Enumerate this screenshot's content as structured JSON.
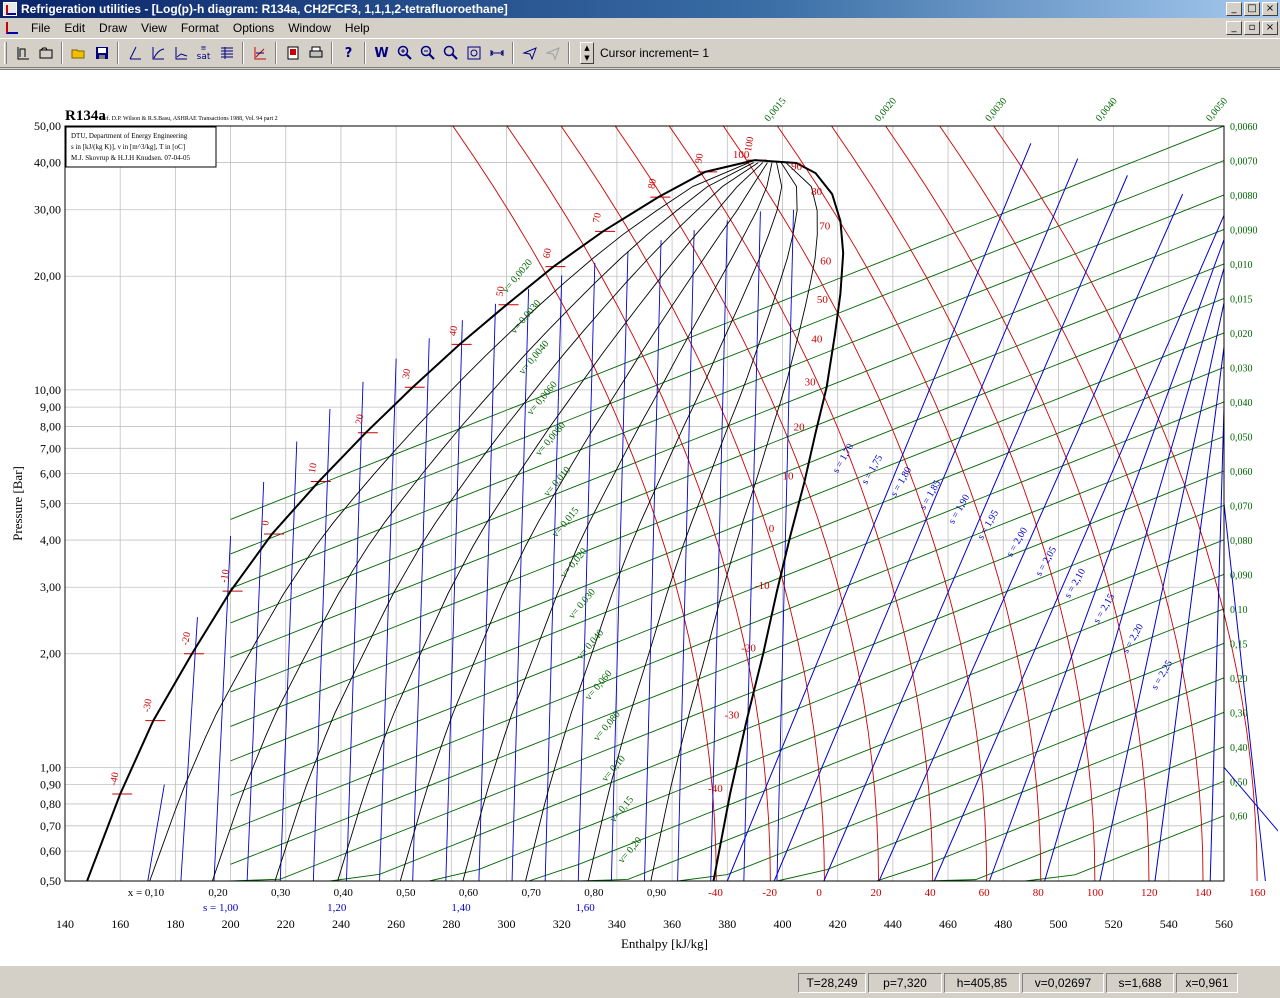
{
  "window": {
    "title": "Refrigeration utilities - [Log(p)-h diagram: R134a, CH2FCF3, 1,1,1,2-tetrafluoroethane]"
  },
  "menu": [
    "File",
    "Edit",
    "Draw",
    "View",
    "Format",
    "Options",
    "Window",
    "Help"
  ],
  "toolbar": {
    "icons": [
      "log-ph-icon",
      "open-folder-icon",
      "folder-icon",
      "save-icon",
      "isentrope-icon",
      "isochore-icon",
      "isotherm-icon",
      "sat-icon",
      "table-icon",
      "cycle-icon",
      "print-preview-icon",
      "print-icon",
      "help-icon",
      "w-icon",
      "zoom-in-icon",
      "zoom-out-icon",
      "zoom-icon",
      "zoom-fit-icon",
      "width-icon",
      "cursor-icon",
      "cursor-disabled-icon"
    ],
    "sat_label": "sat",
    "help_label": "?",
    "w_label": "W",
    "cursor_increment": "Cursor increment= 1"
  },
  "chart": {
    "substance": "R134a",
    "reference": "Ref. D.P. Wilson & R.S.Basu, ASHRAE Transactions 1988, Vol. 94 part 2",
    "info_lines": [
      "DTU, Department of Energy Engineering",
      "s in [kJ/(kg K)], v in [m^3/kg], T in [oC]",
      "M.J. Skovrup & H.J.H Knudsen. 07-04-05"
    ],
    "xlabel": "Enthalpy [kJ/kg]",
    "ylabel": "Pressure [Bar]",
    "x_ticks": [
      "140",
      "160",
      "180",
      "200",
      "220",
      "240",
      "260",
      "280",
      "300",
      "320",
      "340",
      "360",
      "380",
      "400",
      "420",
      "440",
      "460",
      "480",
      "500",
      "520",
      "540",
      "560"
    ],
    "y_ticks": [
      "50,00",
      "40,00",
      "30,00",
      "20,00",
      "10,00",
      "9,00",
      "8,00",
      "7,00",
      "6,00",
      "5,00",
      "4,00",
      "3,00",
      "2,00",
      "1,00",
      "0,90",
      "0,80",
      "0,70",
      "0,60",
      "0,50"
    ],
    "quality_labels": [
      "x = 0,10",
      "0,20",
      "0,30",
      "0,40",
      "0,50",
      "0,60",
      "0,70",
      "0,80",
      "0,90"
    ],
    "entropy_bottom_labels": [
      "s = 1,00",
      "1,20",
      "1,40",
      "1,60"
    ],
    "bottom_temps": [
      "-40",
      "-20",
      "0",
      "20",
      "40",
      "60",
      "80",
      "100",
      "120",
      "140",
      "160"
    ],
    "liquid_temps": [
      "-40",
      "-30",
      "-20",
      "-10",
      "0",
      "10",
      "20",
      "30",
      "40",
      "50",
      "60",
      "70",
      "80",
      "90",
      "100"
    ],
    "vapor_temps": [
      "-40",
      "-30",
      "-20",
      "-10",
      "0",
      "10",
      "20",
      "30",
      "40",
      "50",
      "60",
      "70",
      "80",
      "90",
      "100"
    ],
    "entropy_labels": [
      "s = 1,70",
      "s = 1,75",
      "s = 1,80",
      "s = 1,85",
      "s = 1,90",
      "s = 1,95",
      "s = 2,00",
      "s = 2,05",
      "s = 2,10",
      "s = 2,15",
      "s = 2,20",
      "s = 2,25"
    ],
    "volume_right_labels": [
      "0,0060",
      "0,0070",
      "0,0080",
      "0,0090",
      "0,010",
      "0,015",
      "0,020",
      "0,030",
      "0,040",
      "0,050",
      "0,060",
      "0,070",
      "0,080",
      "0,090",
      "0,10",
      "0,15",
      "0,20",
      "0,30",
      "0,40",
      "0,50",
      "0,60"
    ],
    "volume_top_labels": [
      "0,0015",
      "0,0020",
      "0,0030",
      "0,0040",
      "0,0050"
    ],
    "volume_inner_labels": [
      "v= 0,0020",
      "v= 0,0030",
      "v= 0,0040",
      "v= 0,0060",
      "v= 0,0080",
      "v= 0,010",
      "v= 0,015",
      "v= 0,020",
      "v= 0,030",
      "v= 0,040",
      "v= 0,060",
      "v= 0,080",
      "v= 0,10",
      "v= 0,15",
      "v= 0,20"
    ],
    "colors": {
      "saturation": "#000000",
      "isotherm": "#cc0000",
      "isentrope": "#0000cc",
      "isochore": "#006600",
      "quality": "#000000",
      "grid": "#c0c0c0"
    }
  },
  "status": {
    "T": "T=28,249",
    "p": "p=7,320",
    "h": "h=405,85",
    "v": "v=0,02697",
    "s": "s=1,688",
    "x": "x=0,961"
  }
}
